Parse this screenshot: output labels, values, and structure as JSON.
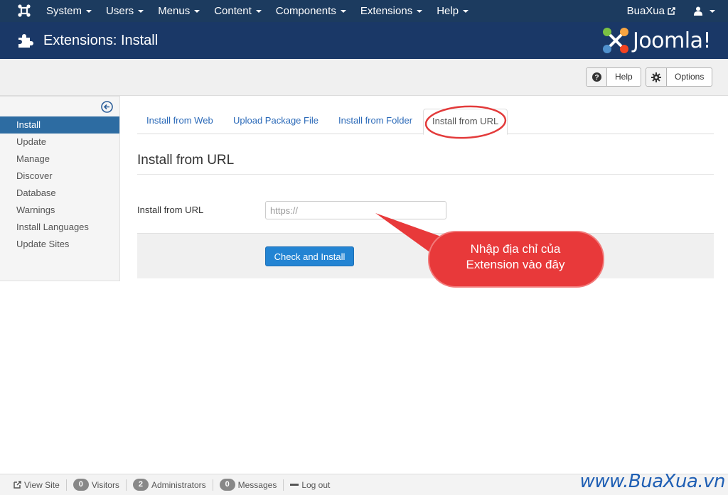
{
  "navbar": {
    "menus": [
      {
        "label": "System"
      },
      {
        "label": "Users"
      },
      {
        "label": "Menus"
      },
      {
        "label": "Content"
      },
      {
        "label": "Components"
      },
      {
        "label": "Extensions"
      },
      {
        "label": "Help"
      }
    ],
    "site_name": "BuaXua"
  },
  "header": {
    "title": "Extensions: Install",
    "brand": "Joomla!"
  },
  "toolbar": {
    "help_label": "Help",
    "options_label": "Options"
  },
  "sidebar": {
    "items": [
      {
        "label": "Install",
        "active": true
      },
      {
        "label": "Update"
      },
      {
        "label": "Manage"
      },
      {
        "label": "Discover"
      },
      {
        "label": "Database"
      },
      {
        "label": "Warnings"
      },
      {
        "label": "Install Languages"
      },
      {
        "label": "Update Sites"
      }
    ]
  },
  "tabs": [
    {
      "label": "Install from Web"
    },
    {
      "label": "Upload Package File"
    },
    {
      "label": "Install from Folder"
    },
    {
      "label": "Install from URL",
      "active": true
    }
  ],
  "form": {
    "heading": "Install from URL",
    "field_label": "Install from URL",
    "url_placeholder": "https://",
    "url_value": "",
    "submit_label": "Check and Install"
  },
  "annotation": {
    "line1": "Nhập địa chỉ của",
    "line2": "Extension vào đây",
    "color": "#e8393a"
  },
  "statusbar": {
    "view_site": "View Site",
    "visitors_count": "0",
    "visitors_label": "Visitors",
    "admins_count": "2",
    "admins_label": "Administrators",
    "messages_count": "0",
    "messages_label": "Messages",
    "logout_label": "Log out"
  },
  "watermark": "www.BuaXua.vn",
  "colors": {
    "navbar": "#1c3b5f",
    "titlebar": "#1a3867",
    "active_sidebar": "#2d6ca2",
    "primary_button": "#2384d3",
    "link": "#2a69b8"
  }
}
